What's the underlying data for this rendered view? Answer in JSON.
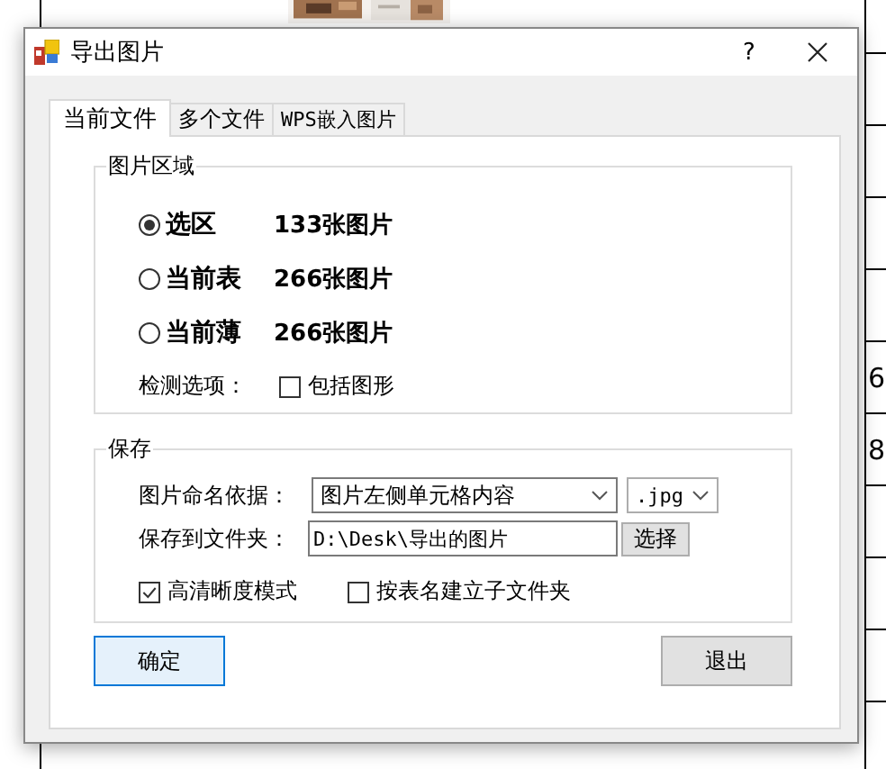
{
  "sheet": {
    "cells": [
      {
        "text": "6"
      },
      {
        "text": "8"
      }
    ]
  },
  "window": {
    "title": "导出图片",
    "help": "?"
  },
  "tabs": [
    {
      "label": "当前文件",
      "selected": true
    },
    {
      "label": "多个文件",
      "selected": false
    },
    {
      "label": "WPS嵌入图片",
      "selected": false
    }
  ],
  "picture_area": {
    "title": "图片区域",
    "options": [
      {
        "label": "选区",
        "count": "133张图片",
        "selected": true
      },
      {
        "label": "当前表",
        "count": "266张图片",
        "selected": false
      },
      {
        "label": "当前薄",
        "count": "266张图片",
        "selected": false
      }
    ],
    "detect_label": "检测选项：",
    "include_shapes": {
      "label": "包括图形",
      "checked": false
    }
  },
  "save": {
    "title": "保存",
    "naming_label": "图片命名依据：",
    "naming_value": "图片左侧单元格内容",
    "format_value": ".jpg",
    "folder_label": "保存到文件夹：",
    "folder_value": "D:\\Desk\\导出的图片",
    "browse": "选择",
    "options": [
      {
        "label": "高清晰度模式",
        "checked": true
      },
      {
        "label": "按表名建立子文件夹",
        "checked": false
      }
    ]
  },
  "buttons": [
    {
      "label": "确定",
      "default": true
    },
    {
      "label": "退出",
      "default": false
    }
  ]
}
